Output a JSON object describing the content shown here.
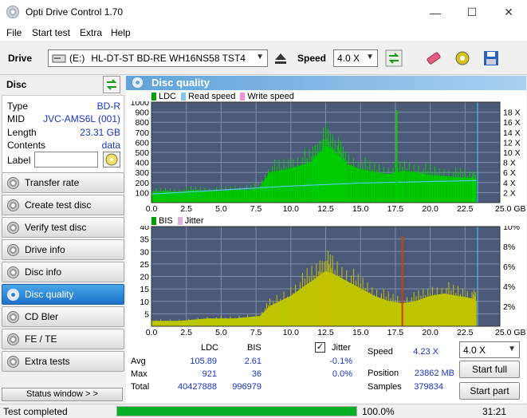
{
  "window": {
    "title": "Opti Drive Control 1.70",
    "minimize": "—",
    "maximize": "☐",
    "close": "✕"
  },
  "menu": [
    "File",
    "Start test",
    "Extra",
    "Help"
  ],
  "drivebar": {
    "drive_label": "Drive",
    "drive_letter": "(E:)",
    "drive_name": "HL-DT-ST BD-RE  WH16NS58 TST4",
    "speed_label": "Speed",
    "speed_value": "4.0 X"
  },
  "disc": {
    "header": "Disc",
    "rows": [
      {
        "key": "Type",
        "value": "BD-R"
      },
      {
        "key": "MID",
        "value": "JVC-AMS6L (001)"
      },
      {
        "key": "Length",
        "value": "23.31 GB"
      },
      {
        "key": "Contents",
        "value": "data"
      }
    ],
    "label_key": "Label",
    "label_placeholder": ""
  },
  "nav": [
    {
      "label": "Transfer rate",
      "active": false
    },
    {
      "label": "Create test disc",
      "active": false
    },
    {
      "label": "Verify test disc",
      "active": false
    },
    {
      "label": "Drive info",
      "active": false
    },
    {
      "label": "Disc info",
      "active": false
    },
    {
      "label": "Disc quality",
      "active": true
    },
    {
      "label": "CD Bler",
      "active": false
    },
    {
      "label": "FE / TE",
      "active": false
    },
    {
      "label": "Extra tests",
      "active": false
    }
  ],
  "status_window_button": "Status window > >",
  "main": {
    "title": "Disc quality"
  },
  "chart_data": [
    {
      "type": "area",
      "legend": [
        "LDC",
        "Read speed",
        "Write speed"
      ],
      "x_ticks": [
        "0.0",
        "2.5",
        "5.0",
        "7.5",
        "10.0",
        "12.5",
        "15.0",
        "17.5",
        "20.0",
        "22.5",
        "25.0 GB"
      ],
      "y_left_ticks": [
        "100",
        "200",
        "300",
        "400",
        "500",
        "600",
        "700",
        "800",
        "900",
        "1000"
      ],
      "y_right_ticks": [
        "2 X",
        "4 X",
        "6 X",
        "8 X",
        "10 X",
        "12 X",
        "14 X",
        "16 X",
        "18 X"
      ],
      "xlim": [
        0,
        25
      ],
      "ylim": [
        0,
        1000
      ],
      "series": [
        {
          "name": "LDC",
          "color": "#00c000",
          "x": [
            0,
            1,
            2,
            3,
            4,
            5,
            6,
            7,
            7.8,
            8.5,
            9.5,
            10.5,
            11.5,
            12,
            12.5,
            13,
            13.5,
            14,
            15,
            16,
            17,
            18,
            19,
            20,
            21,
            22,
            23,
            23.3
          ],
          "y": [
            100,
            110,
            105,
            120,
            115,
            110,
            130,
            120,
            150,
            300,
            320,
            360,
            400,
            480,
            560,
            520,
            450,
            380,
            330,
            300,
            280,
            310,
            300,
            270,
            260,
            250,
            240,
            230
          ]
        },
        {
          "name": "Read speed",
          "color": "#5ac8f0",
          "x": [
            0,
            5,
            10,
            15,
            20,
            23.3
          ],
          "y": [
            1.7,
            2.5,
            3.3,
            3.9,
            4.2,
            4.4
          ]
        }
      ],
      "spikes": [
        {
          "x": 17.6,
          "y": 921
        }
      ]
    },
    {
      "type": "area",
      "legend": [
        "BIS",
        "Jitter"
      ],
      "x_ticks": [
        "0.0",
        "2.5",
        "5.0",
        "7.5",
        "10.0",
        "12.5",
        "15.0",
        "17.5",
        "20.0",
        "22.5",
        "25.0 GB"
      ],
      "y_left_ticks": [
        "5",
        "10",
        "15",
        "20",
        "25",
        "30",
        "35",
        "40"
      ],
      "y_right_ticks": [
        "2%",
        "4%",
        "6%",
        "8%",
        "10%"
      ],
      "xlim": [
        0,
        25
      ],
      "ylim": [
        0,
        40
      ],
      "series": [
        {
          "name": "BIS",
          "color": "#b8c800",
          "x": [
            0,
            2,
            4,
            6,
            7.8,
            8.5,
            10,
            11,
            12,
            12.5,
            13,
            14,
            15,
            16,
            17,
            18,
            19,
            20,
            21,
            22,
            23,
            23.3
          ],
          "y": [
            2,
            2,
            3,
            3,
            4,
            8,
            12,
            16,
            20,
            22,
            21,
            18,
            15,
            12,
            10,
            9,
            10,
            12,
            13,
            12,
            11,
            10
          ]
        }
      ],
      "spikes": [
        {
          "x": 18,
          "y": 36
        }
      ]
    }
  ],
  "stats": {
    "col_ldc": "LDC",
    "col_bis": "BIS",
    "jitter_label": "Jitter",
    "jitter_checked": true,
    "rows": [
      {
        "label": "Avg",
        "ldc": "105.89",
        "bis": "2.61",
        "jitter": "-0.1%"
      },
      {
        "label": "Max",
        "ldc": "921",
        "bis": "36",
        "jitter": "0.0%"
      },
      {
        "label": "Total",
        "ldc": "40427888",
        "bis": "996979",
        "jitter": ""
      }
    ],
    "speed_label": "Speed",
    "speed_value": "4.23 X",
    "position_label": "Position",
    "position_value": "23862 MB",
    "samples_label": "Samples",
    "samples_value": "379834",
    "speed_select": "4.0 X",
    "start_full": "Start full",
    "start_part": "Start part"
  },
  "statusbar": {
    "text": "Test completed",
    "progress": 1.0,
    "percent": "100.0%",
    "time": "31:21"
  }
}
